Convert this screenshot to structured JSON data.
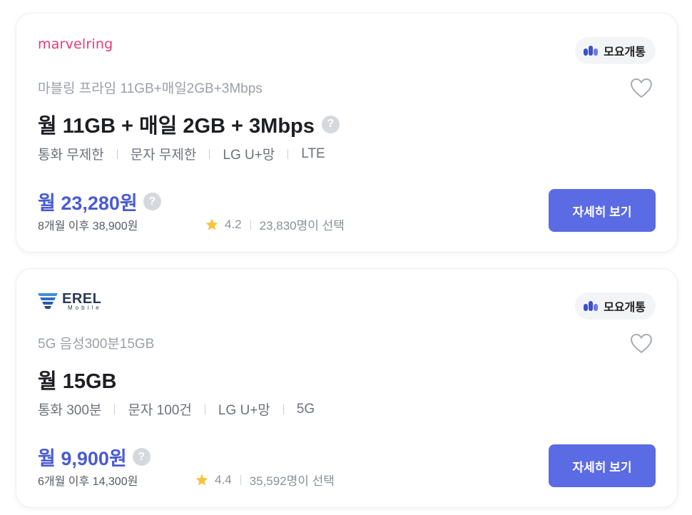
{
  "badge_label": "모요개통",
  "plans": [
    {
      "provider_logo_text": "marvelring",
      "plan_name": "마블링 프라임 11GB+매일2GB+3Mbps",
      "plan_title": "월 11GB + 매일 2GB + 3Mbps",
      "features": [
        "통화 무제한",
        "문자 무제한",
        "LG U+망",
        "LTE"
      ],
      "price": "월 23,280원",
      "after_price": "8개월 이후 38,900원",
      "rating": "4.2",
      "selected_count": "23,830명이 선택",
      "detail_button": "자세히 보기",
      "show_title_help": true
    },
    {
      "provider_logo_text": "EREL",
      "provider_logo_sub": "Mobile",
      "plan_name": "5G 음성300분15GB",
      "plan_title": "월 15GB",
      "features": [
        "통화 300분",
        "문자 100건",
        "LG U+망",
        "5G"
      ],
      "price": "월 9,900원",
      "after_price": "6개월 이후 14,300원",
      "rating": "4.4",
      "selected_count": "35,592명이 선택",
      "detail_button": "자세히 보기",
      "show_title_help": false
    }
  ],
  "colors": {
    "accent": "#5b6be3",
    "price": "#4a5bd0",
    "brand_marvelring": "#e8387a",
    "brand_erel": "#2b3a55",
    "star": "#f5c23b"
  },
  "icons": {
    "help": "question-circle-icon",
    "favorite": "heart-outline-icon",
    "rating": "star-icon",
    "badge": "moyo-logo-icon"
  }
}
